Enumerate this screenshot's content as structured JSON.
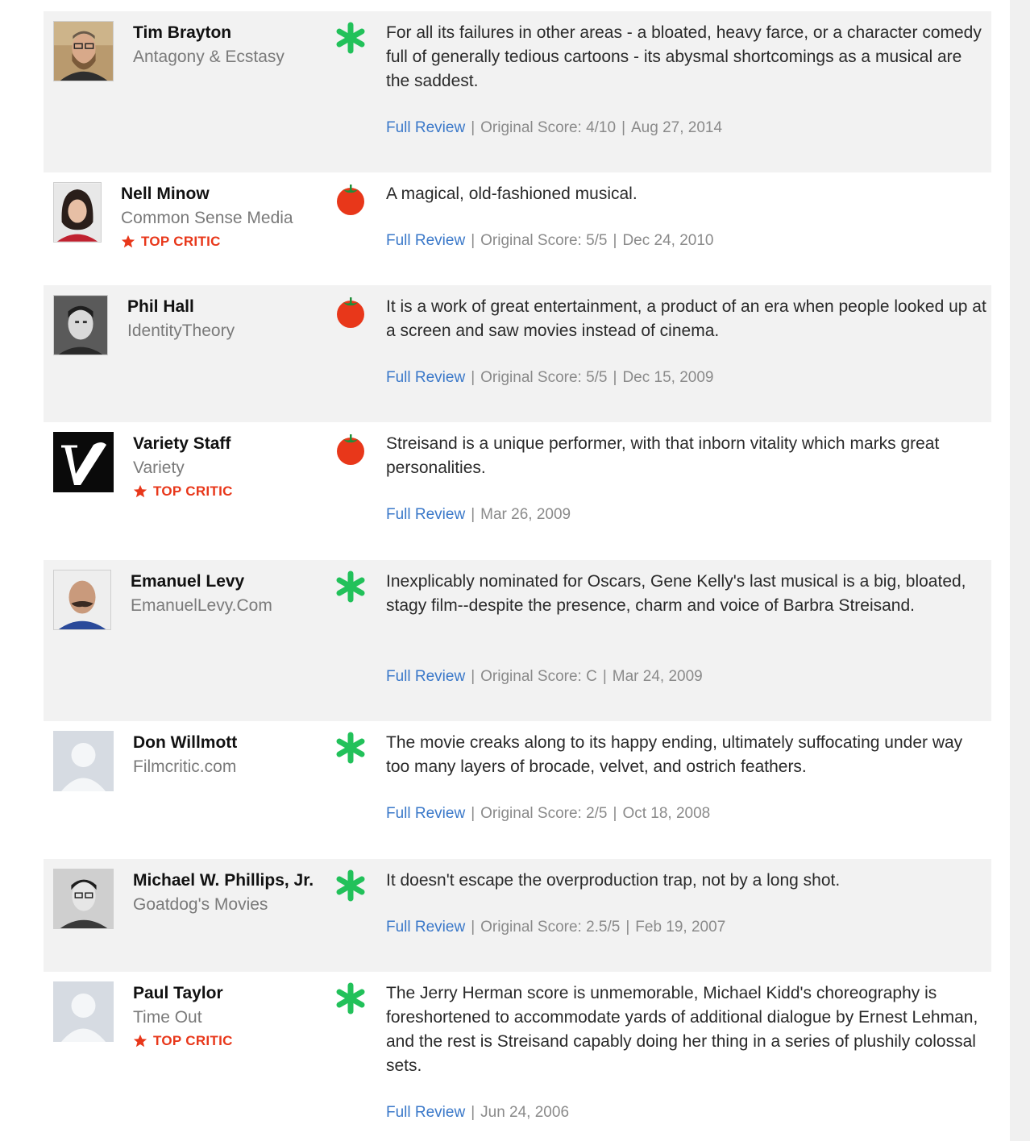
{
  "colors": {
    "fresh": "#e8371a",
    "rotten": "#22c15a",
    "link": "#3a78c9",
    "top_critic": "#e8371a"
  },
  "reviews": [
    {
      "critic": "Tim Brayton",
      "publication": "Antagony & Ecstasy",
      "top_critic": "",
      "score": "rotten",
      "avatar": "photo-man-beard-glasses",
      "quote": "For all its failures in other areas - a bloated, heavy farce, or a character comedy full of generally tedious cartoons - its abysmal shortcomings as a musical are the saddest.",
      "link": "Full Review",
      "original_score": "Original Score: 4/10",
      "date": "Aug 27, 2014"
    },
    {
      "critic": "Nell Minow",
      "publication": "Common Sense Media",
      "top_critic": "TOP CRITIC",
      "score": "fresh",
      "avatar": "photo-woman-dark-hair",
      "quote": "A magical, old-fashioned musical.",
      "link": "Full Review",
      "original_score": "Original Score: 5/5",
      "date": "Dec 24, 2010"
    },
    {
      "critic": "Phil Hall",
      "publication": "IdentityTheory",
      "top_critic": "",
      "score": "fresh",
      "avatar": "photo-man-bw",
      "quote": "It is a work of great entertainment, a product of an era when people looked up at a screen and saw movies instead of cinema.",
      "link": "Full Review",
      "original_score": "Original Score: 5/5",
      "date": "Dec 15, 2009"
    },
    {
      "critic": "Variety Staff",
      "publication": "Variety",
      "top_critic": "TOP CRITIC",
      "score": "fresh",
      "avatar": "variety-v-logo",
      "quote": "Streisand is a unique performer, with that inborn vitality which marks great personalities.",
      "link": "Full Review",
      "original_score": "",
      "date": "Mar 26, 2009"
    },
    {
      "critic": "Emanuel Levy",
      "publication": "EmanuelLevy.Com",
      "top_critic": "",
      "score": "rotten",
      "avatar": "photo-man-mustache",
      "quote": "Inexplicably nominated for Oscars, Gene Kelly's last musical is a big, bloated, stagy film--despite the presence, charm and voice of Barbra Streisand.",
      "link": "Full Review",
      "original_score": "Original Score: C",
      "date": "Mar 24, 2009"
    },
    {
      "critic": "Don Willmott",
      "publication": "Filmcritic.com",
      "top_critic": "",
      "score": "rotten",
      "avatar": "default-avatar",
      "quote": "The movie creaks along to its happy ending, ultimately suffocating under way too many layers of brocade, velvet, and ostrich feathers.",
      "link": "Full Review",
      "original_score": "Original Score: 2/5",
      "date": "Oct 18, 2008"
    },
    {
      "critic": "Michael W. Phillips, Jr.",
      "publication": "Goatdog's Movies",
      "top_critic": "",
      "score": "rotten",
      "avatar": "photo-man-glasses-bw",
      "quote": "It doesn't escape the overproduction trap, not by a long shot.",
      "link": "Full Review",
      "original_score": "Original Score: 2.5/5",
      "date": "Feb 19, 2007"
    },
    {
      "critic": "Paul Taylor",
      "publication": "Time Out",
      "top_critic": "TOP CRITIC",
      "score": "rotten",
      "avatar": "default-avatar",
      "quote": "The Jerry Herman score is unmemorable, Michael Kidd's choreography is foreshortened to accommodate yards of additional dialogue by Ernest Lehman, and the rest is Streisand capably doing her thing in a series of plushily colossal sets.",
      "link": "Full Review",
      "original_score": "",
      "date": "Jun 24, 2006"
    }
  ]
}
